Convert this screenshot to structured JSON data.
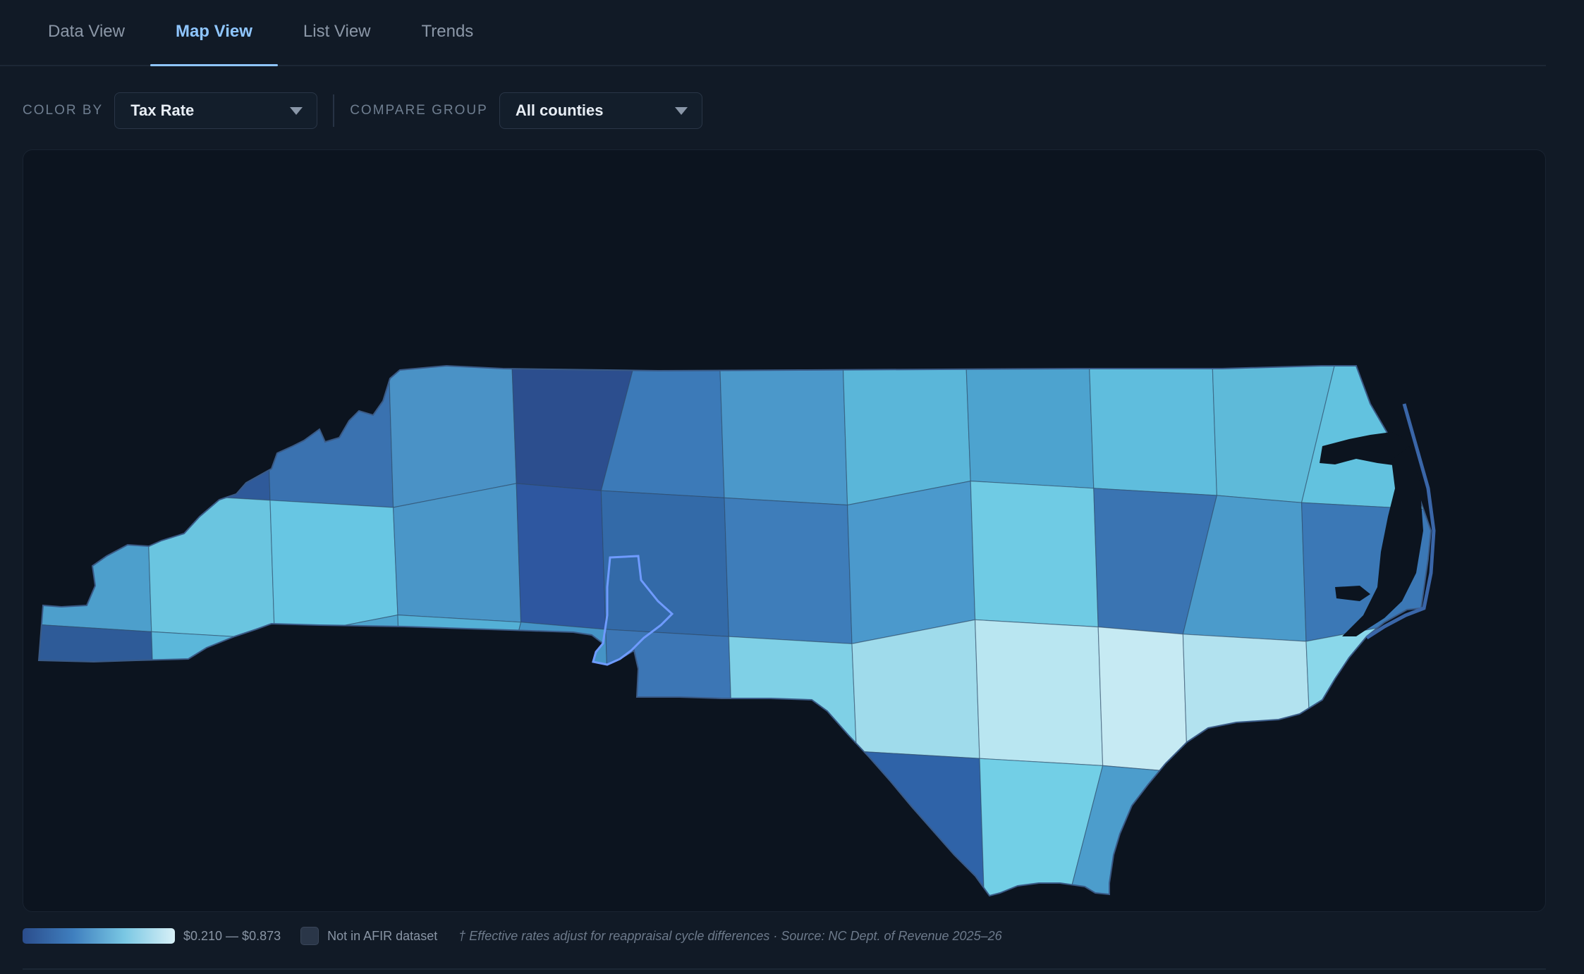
{
  "tabs": [
    {
      "label": "Data View",
      "active": false
    },
    {
      "label": "Map View",
      "active": true
    },
    {
      "label": "List View",
      "active": false
    },
    {
      "label": "Trends",
      "active": false
    }
  ],
  "controls": {
    "color_by_label": "COLOR BY",
    "color_by_value": "Tax Rate",
    "compare_label": "COMPARE GROUP",
    "compare_value": "All counties"
  },
  "legend": {
    "range": "$0.210 — $0.873",
    "not_in_dataset": "Not in AFIR dataset",
    "source": "† Effective rates adjust for reappraisal cycle differences · Source: NC Dept. of Revenue 2025–26"
  },
  "colors": {
    "background": "#111a26",
    "accent": "#8fc6ff",
    "scale_low": "#2b4d8c",
    "scale_high": "#d8f0f7",
    "not_in_dataset": "#2a3648"
  },
  "map": {
    "region": "North Carolina",
    "metric": "Tax Rate",
    "counties": [
      {
        "fill": "#3d79b8"
      },
      {
        "fill": "#2f5a9a"
      },
      {
        "fill": "#3a72b0"
      },
      {
        "fill": "#4a92c6"
      },
      {
        "fill": "#2c4e8e"
      },
      {
        "fill": "#3c7ab8"
      },
      {
        "fill": "#4b98ca"
      },
      {
        "fill": "#5ab6d9"
      },
      {
        "fill": "#4da3cf"
      },
      {
        "fill": "#5fbddd"
      },
      {
        "fill": "#5ebad9"
      },
      {
        "fill": "#62c2df"
      },
      {
        "fill": "#4d9fcc"
      },
      {
        "fill": "#6ac5e0"
      },
      {
        "fill": "#67c6e3"
      },
      {
        "fill": "#4a96c8"
      },
      {
        "fill": "#2e57a0"
      },
      {
        "fill": "#336aa8"
      },
      {
        "fill": "#3e7dba"
      },
      {
        "fill": "#4b99cc"
      },
      {
        "fill": "#6fcbe4"
      },
      {
        "fill": "#3a74b2"
      },
      {
        "fill": "#4b9bcb"
      },
      {
        "fill": "#3b78b6"
      },
      {
        "fill": "#2e5b98"
      },
      {
        "fill": "#5bb7da"
      },
      {
        "fill": "#4fa6d0"
      },
      {
        "fill": "#54b0d6"
      },
      {
        "fill": "#4594c6"
      },
      {
        "fill": "#3c76b5"
      },
      {
        "fill": "#7fd0e6"
      },
      {
        "fill": "#9fdbeb"
      },
      {
        "fill": "#b9e6f1"
      },
      {
        "fill": "#c6eaf3"
      },
      {
        "fill": "#b2e2ef"
      },
      {
        "fill": "#8ad7ea"
      },
      {
        "fill": "#3d7cb9"
      },
      {
        "fill": "#2d5fa4"
      },
      {
        "fill": "#2b4a8a"
      },
      {
        "fill": "#6bc7e2"
      },
      {
        "fill": "#57b3d7"
      },
      {
        "fill": "#7ad3e7"
      },
      {
        "fill": "#3b7ebe"
      },
      {
        "fill": "#2f63a8"
      },
      {
        "fill": "#72cfe6"
      },
      {
        "fill": "#4c9dcc"
      },
      {
        "fill": "#49a3d0"
      },
      {
        "fill": "#2e5fa3"
      }
    ]
  }
}
